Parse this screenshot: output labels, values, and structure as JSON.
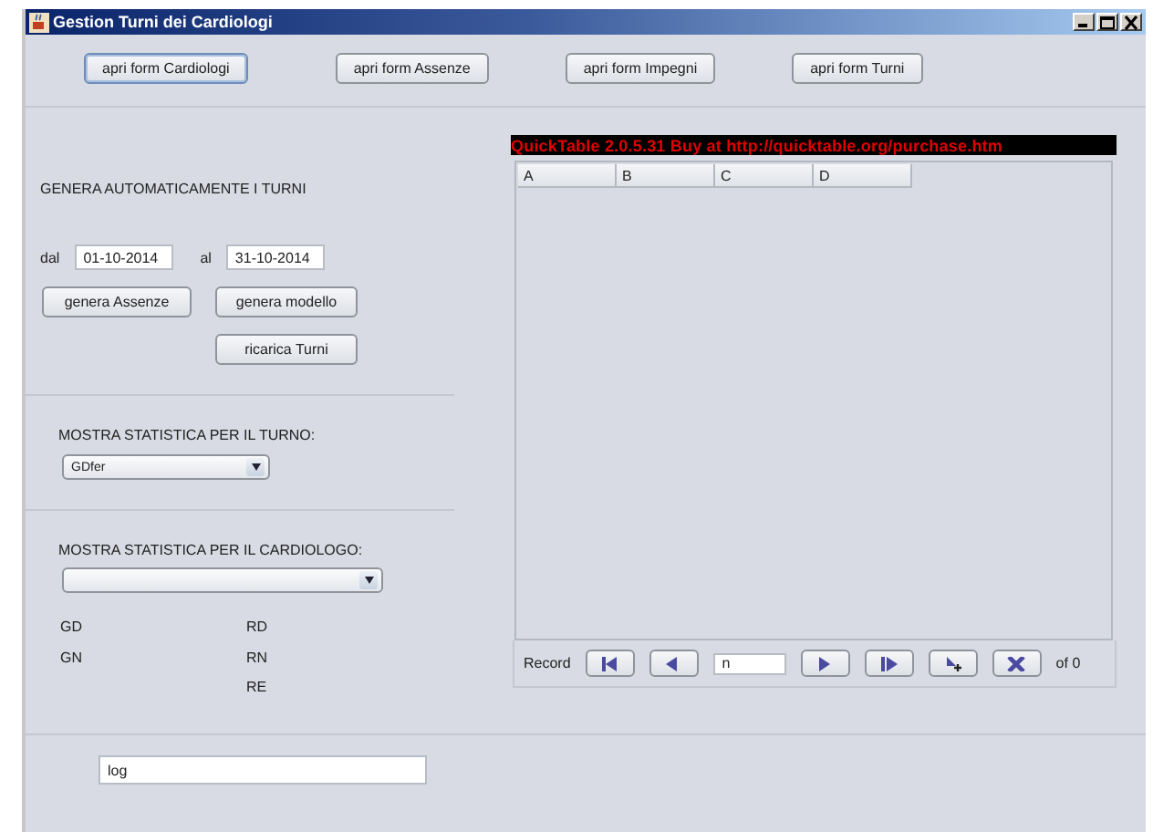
{
  "window": {
    "title": "Gestion Turni dei Cardiologi"
  },
  "top_buttons": [
    {
      "label": "apri form Cardiologi",
      "focused": true
    },
    {
      "label": "apri form Assenze",
      "focused": false
    },
    {
      "label": "apri form Impegni",
      "focused": false
    },
    {
      "label": "apri form Turni",
      "focused": false
    }
  ],
  "generate": {
    "heading": "GENERA AUTOMATICAMENTE I TURNI",
    "from_label": "dal",
    "from_value": "01-10-2014",
    "to_label": "al",
    "to_value": "31-10-2014",
    "buttons": [
      "genera Assenze",
      "genera modello",
      "ricarica Turni"
    ]
  },
  "shift_stats": {
    "label": "MOSTRA STATISTICA PER IL TURNO:",
    "value": "GDfer"
  },
  "cardiologist_stats": {
    "label": "MOSTRA STATISTICA PER IL CARDIOLOGO:",
    "left": [
      "GD",
      "GN"
    ],
    "right": [
      "RD",
      "RN",
      "RE"
    ]
  },
  "log": {
    "value": "log"
  },
  "table": {
    "banner": "QuickTable 2.0.5.31 Buy at http://quicktable.org/purchase.htm",
    "columns": [
      "A",
      "B",
      "C",
      "D"
    ]
  },
  "navigator": {
    "label": "Record",
    "value": "n",
    "total": "of 0",
    "buttons": [
      {
        "kind": "first"
      },
      {
        "kind": "prev"
      },
      {
        "kind": "next"
      },
      {
        "kind": "last"
      },
      {
        "kind": "add"
      },
      {
        "kind": "delete"
      }
    ]
  }
}
